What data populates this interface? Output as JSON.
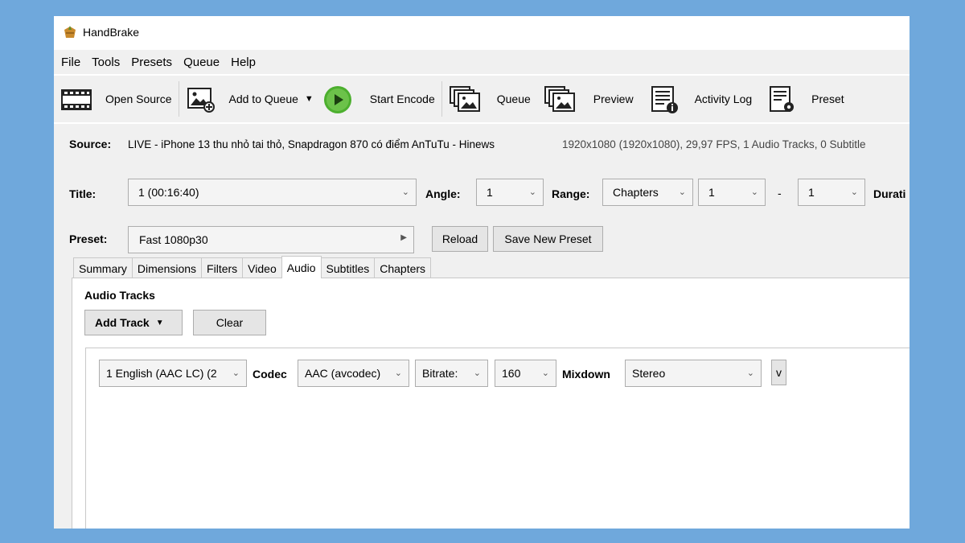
{
  "app": {
    "title": "HandBrake"
  },
  "menu": [
    "File",
    "Tools",
    "Presets",
    "Queue",
    "Help"
  ],
  "toolbar": {
    "open_source": "Open Source",
    "add_to_queue": "Add to Queue",
    "start_encode": "Start Encode",
    "queue": "Queue",
    "preview": "Preview",
    "activity_log": "Activity Log",
    "presets": "Preset"
  },
  "source": {
    "label": "Source:",
    "name": "LIVE - iPhone 13 thu nhỏ tai thỏ, Snapdragon 870 có điểm AnTuTu - Hinews",
    "meta": "1920x1080 (1920x1080), 29,97 FPS, 1 Audio Tracks, 0 Subtitle"
  },
  "title_row": {
    "title_label": "Title:",
    "title_value": "1 (00:16:40)",
    "angle_label": "Angle:",
    "angle_value": "1",
    "range_label": "Range:",
    "range_value": "Chapters",
    "range_start": "1",
    "dash": "-",
    "range_end": "1",
    "duration_label": "Durati"
  },
  "preset_row": {
    "label": "Preset:",
    "value": "Fast 1080p30",
    "reload": "Reload",
    "save_new": "Save New Preset"
  },
  "tabs": [
    "Summary",
    "Dimensions",
    "Filters",
    "Video",
    "Audio",
    "Subtitles",
    "Chapters"
  ],
  "audio": {
    "heading": "Audio Tracks",
    "add_track": "Add Track",
    "clear": "Clear",
    "track": {
      "source": "1 English (AAC LC) (2",
      "codec_label": "Codec",
      "codec_value": "AAC (avcodec)",
      "bitrate_mode": "Bitrate:",
      "bitrate_value": "160",
      "mixdown_label": "Mixdown",
      "mixdown_value": "Stereo",
      "more": "v"
    }
  }
}
